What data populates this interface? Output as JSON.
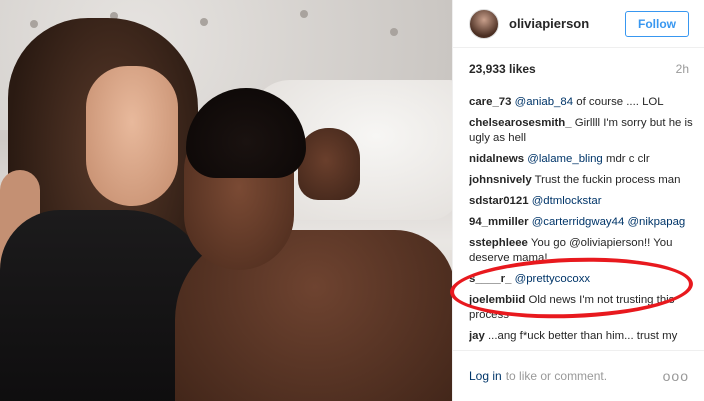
{
  "header": {
    "username": "oliviapierson",
    "follow_label": "Follow"
  },
  "meta": {
    "likes": "23,933 likes",
    "time": "2h"
  },
  "comments": [
    {
      "user": "care_73",
      "mention": "@aniab_84",
      "text": " of course .... LOL"
    },
    {
      "user": "chelsearosesmith_",
      "mention": "",
      "text": " Girllll I'm sorry but he is ugly as hell"
    },
    {
      "user": "nidalnews",
      "mention": "@lalame_bling",
      "text": " mdr c clr"
    },
    {
      "user": "johnsnively",
      "mention": "",
      "text": " Trust the fuckin process man"
    },
    {
      "user": "sdstar0121",
      "mention": "@dtmlockstar",
      "text": ""
    },
    {
      "user": "94_mmiller",
      "mention": "@carterridgway44 @nikpapag",
      "text": ""
    },
    {
      "user": "sstephleee",
      "mention": "",
      "text": " You go @oliviapierson!! You deserve mama!"
    },
    {
      "user": "s____r_",
      "mention": "@prettycocoxx",
      "text": ""
    },
    {
      "user": "joelembiid",
      "mention": "",
      "text": " Old news I'm not trusting this process"
    },
    {
      "user": "jay",
      "mention": "",
      "text": " ...ang f*uck better than him... trust my process. Hit my dm shawty"
    }
  ],
  "footer": {
    "login_label": "Log in",
    "text": "to like or comment.",
    "more": "ooo"
  },
  "colors": {
    "accent": "#3897f0",
    "annotation": "#e8191e",
    "link": "#003569"
  }
}
